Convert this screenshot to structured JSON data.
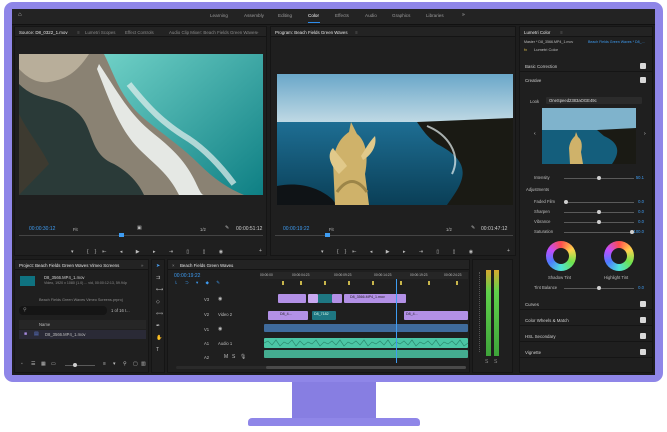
{
  "workspaces": [
    "Learning",
    "Assembly",
    "Editing",
    "Color",
    "Effects",
    "Audio",
    "Graphics",
    "Libraries"
  ],
  "active_workspace": "Color",
  "source_panel": {
    "tabs": [
      "Source: D8_0322_1.mov",
      "Lumetri Scopes",
      "Effect Controls",
      "Audio Clip Mixer: Beach Fields Green Waves"
    ],
    "timecode": "00:00:30:12",
    "fit": "Fit",
    "ratio": "1/2",
    "duration": "00:00:51:12"
  },
  "program_panel": {
    "title": "Program: Beach Fields Green Waves",
    "timecode": "00:00:19:22",
    "fit": "Fit",
    "ratio": "1/2",
    "duration": "00:01:47:12"
  },
  "project_panel": {
    "title": "Project: Beach Fields Green Waves Vimeo Screens",
    "clip_name": "D8_3566.MP4_1.mov",
    "clip_meta": "Video, 1920 x 1080 (1.0)  ...  vid, 00:00:12:13, 59.94p",
    "bin_path": "Beach Fields Green Waves Vimeo Screens.prproj",
    "item_count": "1 of 16 I...",
    "col_name": "Name",
    "item": "D8_3566.MP4_1.mov"
  },
  "timeline": {
    "title": "Beach Fields Green Waves",
    "timecode": "00:00:19:22",
    "ruler": [
      "00:00:00",
      "00:00:04:23",
      "00:00:09:23",
      "00:00:14:23",
      "00:00:19:23",
      "00:00:24:23"
    ],
    "tracks": [
      "V3",
      "V2",
      "V1",
      "A1",
      "A2"
    ],
    "track_names": [
      "",
      "Video 2",
      "",
      "Audio 1",
      ""
    ],
    "clips": [
      "D8_3566.MP4_1.mov",
      "D8_4...",
      "D8_7182",
      "D8_4..."
    ]
  },
  "lumetri": {
    "title": "Lumetri Color",
    "master": "Master * D8_3566.MP4_1.mov",
    "sequence": "Beach Fields Green Waves * D8_...",
    "fx": "fx",
    "effect": "Lumetri Color",
    "sections": {
      "basic": "Basic Correction",
      "creative": "Creative",
      "curves": "Curves",
      "color_wheels": "Color Wheels & Match",
      "hsl": "HSL Secondary",
      "vignette": "Vignette"
    },
    "look_label": "Look",
    "look_value": "OneSpeed2383aOGE49c",
    "intensity_label": "Intensity",
    "intensity_value": "50.1",
    "adjustments_label": "Adjustments",
    "adjust": [
      {
        "label": "Faded Film",
        "value": "0.0",
        "level": 0.0
      },
      {
        "label": "Sharpen",
        "value": "0.0",
        "level": 0.5
      },
      {
        "label": "Vibrance",
        "value": "0.0",
        "level": 0.5
      },
      {
        "label": "Saturation",
        "value": "100.0",
        "level": 1.0
      }
    ],
    "shadow_tint": "Shadow Tint",
    "highlight_tint": "Highlight Tint",
    "tint_balance_label": "Tint Balance",
    "tint_balance_value": "0.0"
  },
  "colors": {
    "monitor": "#8f86e8",
    "accent": "#3e9cf2",
    "clip_purple": "#b290e6",
    "clip_teal": "#4bc6a5"
  }
}
